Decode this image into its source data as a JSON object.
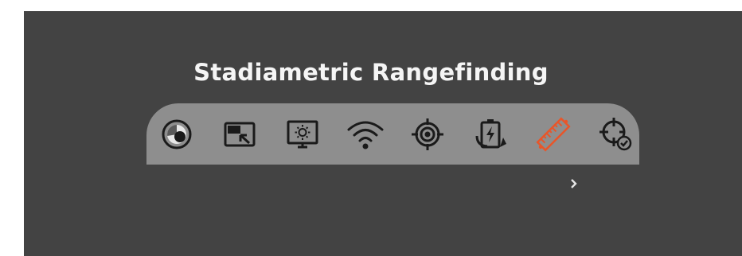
{
  "menu": {
    "title": "Stadiametric Rangefinding",
    "selected_item": "rangefinder-ruler",
    "items": [
      {
        "icon": "color-palette-icon"
      },
      {
        "icon": "picture-in-picture-icon"
      },
      {
        "icon": "display-brightness-icon"
      },
      {
        "icon": "wifi-icon"
      },
      {
        "icon": "reticle-target-icon"
      },
      {
        "icon": "battery-charging-icon"
      },
      {
        "icon": "rangefinder-ruler-icon"
      },
      {
        "icon": "zero-calibration-icon"
      }
    ],
    "next_indicator": "chevron-right-icon"
  },
  "colors": {
    "background": "#434343",
    "toolbar": "#8e8e8e",
    "icon": "#1a1a1a",
    "selected": "#e8562a",
    "title": "#f5f5f5"
  }
}
